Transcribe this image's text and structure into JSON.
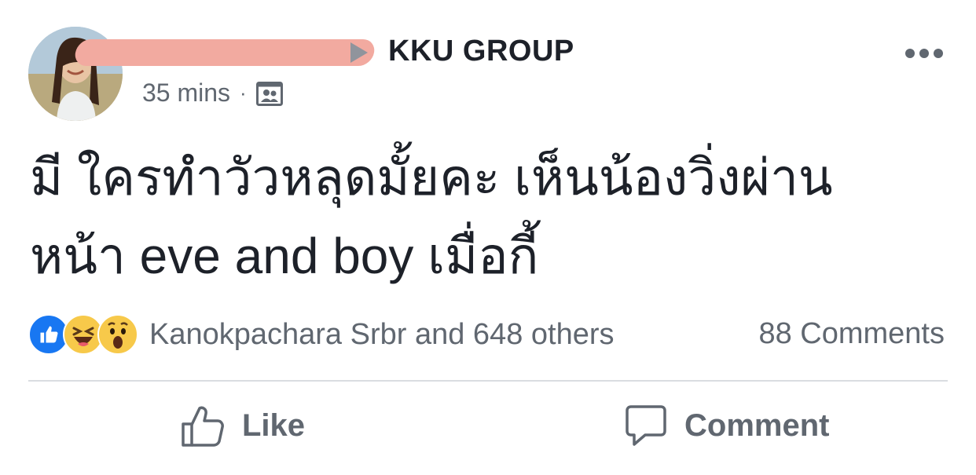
{
  "post": {
    "group_name": "KKU GROUP",
    "time": "35 mins",
    "separator": "·",
    "text_line1": "มี ใครทำวัวหลุดมั้ยคะ เห็นน้องวิ่งผ่าน",
    "text_line2": "หน้า eve and boy เมื่อกี้"
  },
  "reactions": {
    "icons": [
      "like-reaction-icon",
      "haha-reaction-icon",
      "wow-reaction-icon"
    ],
    "summary": "Kanokpachara Srbr and 648 others",
    "comments": "88 Comments"
  },
  "actions": {
    "like_label": "Like",
    "comment_label": "Comment"
  },
  "colors": {
    "text": "#1d2129",
    "secondary": "#606770",
    "like_blue": "#1877f2",
    "emoji_yellow": "#f7c94a",
    "redaction": "#f2aaa0"
  }
}
